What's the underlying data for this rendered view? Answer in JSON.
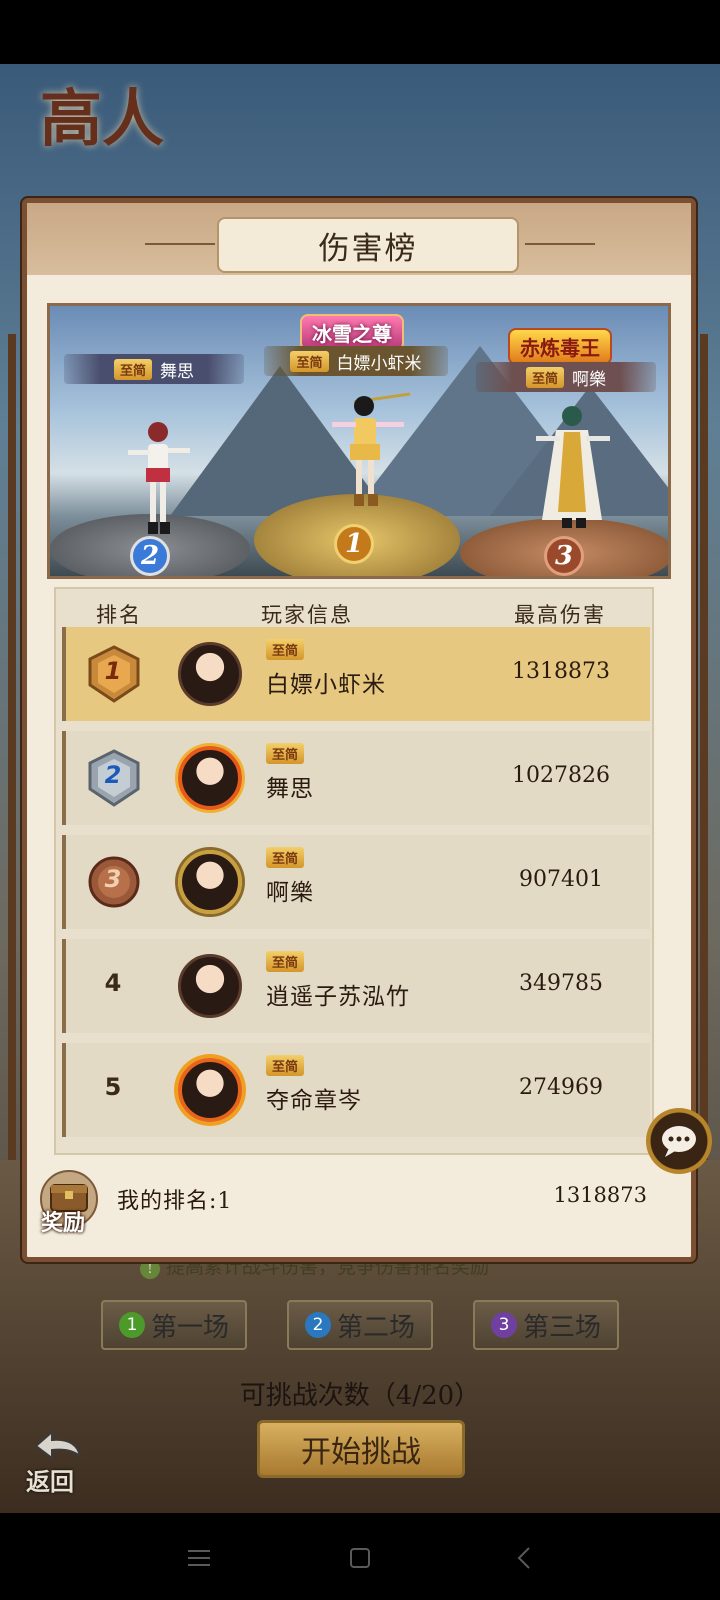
{
  "scene": {
    "title": "高人"
  },
  "panel": {
    "title": "伤害榜"
  },
  "podium": {
    "first": {
      "honor": "冰雪之尊",
      "vip": "至简",
      "name": "白嫖小虾米",
      "rank": "1"
    },
    "second": {
      "vip": "至简",
      "name": "舞思",
      "rank": "2"
    },
    "third": {
      "honor": "赤炼毒王",
      "vip": "至简",
      "name": "啊樂",
      "rank": "3"
    }
  },
  "table": {
    "headers": {
      "rank": "排名",
      "player": "玩家信息",
      "damage": "最高伤害"
    },
    "rows": [
      {
        "rank": "1",
        "vip": "至简",
        "name": "白嫖小虾米",
        "damage": "1318873"
      },
      {
        "rank": "2",
        "vip": "至简",
        "name": "舞思",
        "damage": "1027826"
      },
      {
        "rank": "3",
        "vip": "至简",
        "name": "啊樂",
        "damage": "907401"
      },
      {
        "rank": "4",
        "vip": "至简",
        "name": "逍遥子苏泓竹",
        "damage": "349785"
      },
      {
        "rank": "5",
        "vip": "至简",
        "name": "夺命章岑",
        "damage": "274969"
      }
    ]
  },
  "footer": {
    "reward_label": "奖励",
    "my_rank": "我的排名:1",
    "my_damage": "1318873"
  },
  "tip": {
    "icon": "!",
    "text": "提高累计战斗伤害，竞争伤害排名奖励"
  },
  "rounds": [
    {
      "num": "1",
      "label": "第一场"
    },
    {
      "num": "2",
      "label": "第二场"
    },
    {
      "num": "3",
      "label": "第三场"
    }
  ],
  "challenge_count": "可挑战次数（4/20）",
  "start_button": "开始挑战",
  "back_label": "返回",
  "colors": {
    "gold_row": "#e6c880",
    "panel_bg": "#f3ecdc",
    "frame": "#7a5032"
  }
}
